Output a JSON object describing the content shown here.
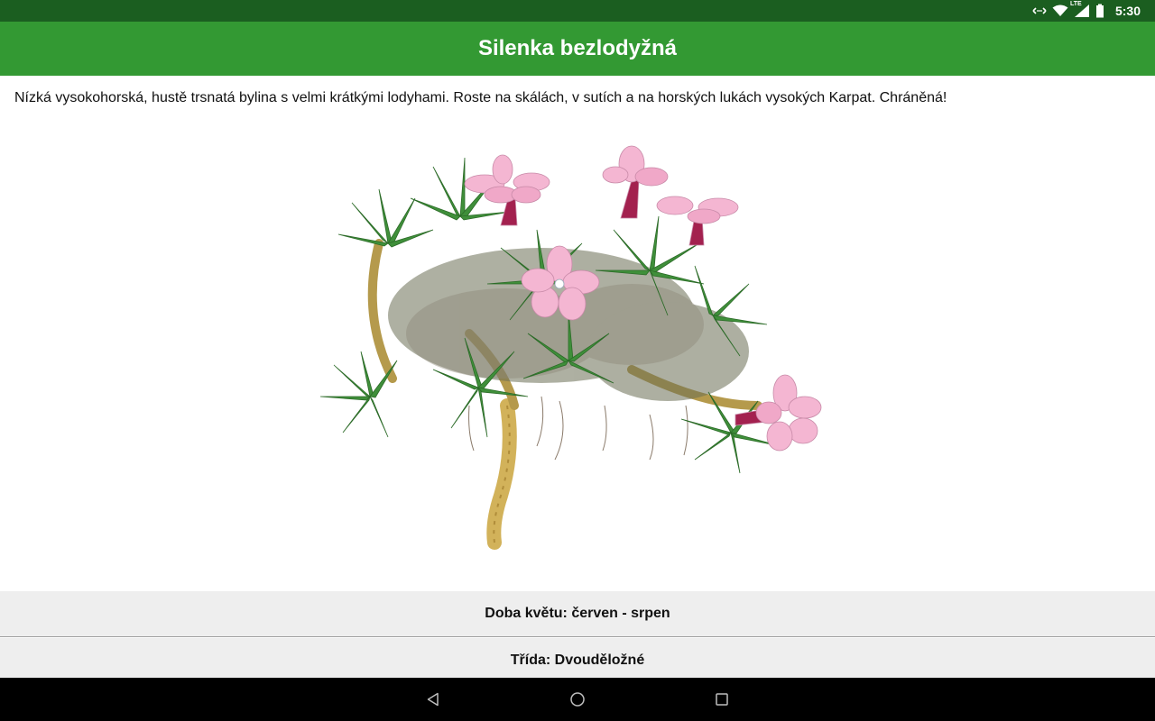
{
  "status_bar": {
    "network_type": "LTE",
    "time": "5:30",
    "icons": [
      "data-sync-icon",
      "wifi-icon",
      "cellular-signal-icon",
      "battery-icon"
    ]
  },
  "app_bar": {
    "title": "Silenka bezlodyžná"
  },
  "content": {
    "description": "Nízká vysokohorská, hustě trsnatá bylina s velmi krátkými lodyhami. Roste na skálách, v sutích a na horských lukách vysokých Karpat. Chráněná!",
    "bloom_time": "Doba květu: červen - srpen",
    "plant_class": "Třída: Dvouděložné"
  },
  "nav_bar": {
    "buttons": [
      "back-icon",
      "home-icon",
      "recents-icon"
    ]
  },
  "colors": {
    "status_bar": "#1b5e20",
    "app_bar": "#339933",
    "info_row": "#eeeeee",
    "nav_bar": "#000000",
    "petal": "#f4b6d2",
    "calyx": "#a3214f",
    "leaf": "#3f8f3a"
  }
}
